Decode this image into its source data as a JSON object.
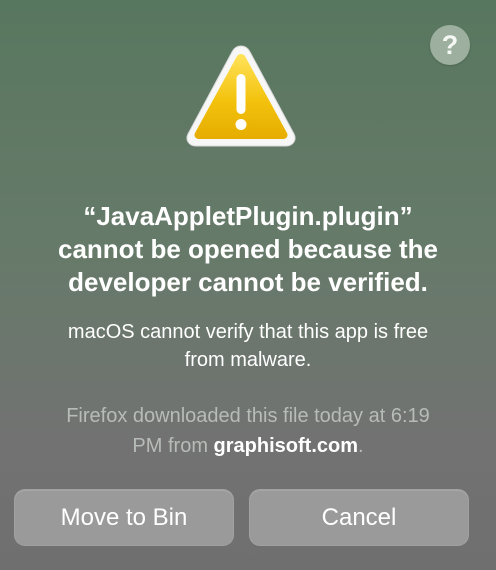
{
  "dialog": {
    "help_label": "?",
    "title_lines": [
      "“JavaAppletPlugin.plugin”",
      "cannot be opened because the",
      "developer cannot be verified."
    ],
    "message_lines": [
      "macOS cannot verify that this app is free",
      "from malware."
    ],
    "source": {
      "line1": "Firefox downloaded this file today at 6:19",
      "line2_prefix": "PM from ",
      "domain": "graphisoft.com",
      "line2_suffix": "."
    },
    "buttons": {
      "move_to_bin": "Move to Bin",
      "cancel": "Cancel"
    }
  },
  "icons": {
    "warning": "warning-triangle-icon",
    "help": "help-icon"
  },
  "colors": {
    "background_top": "#58775f",
    "background_bottom": "#6f6f6f",
    "warning_yellow": "#f2c400",
    "button_gray": "#9a9a9a",
    "secondary_text": "#b7bcb8"
  }
}
